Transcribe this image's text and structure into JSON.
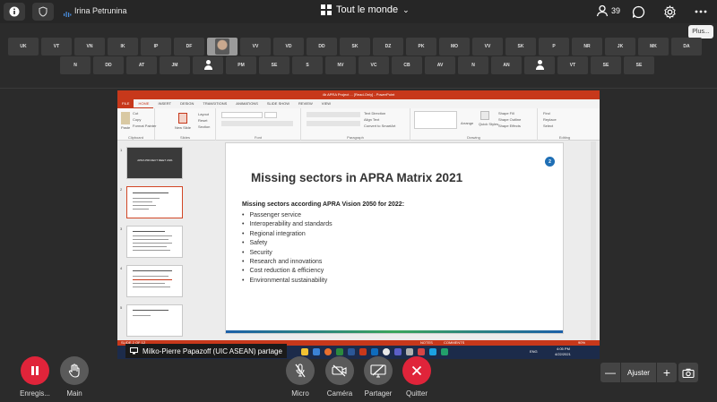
{
  "topbar": {
    "user_name": "Irina Petrunina",
    "layout_label": "Tout le monde",
    "participant_count": "39",
    "tooltip": "Plus..."
  },
  "participants": {
    "row1": [
      "UK",
      "VT",
      "VN",
      "IK",
      "IP",
      "DF",
      "",
      "VV",
      "VD",
      "DD",
      "SK",
      "DZ",
      "PK",
      "MO",
      "VV",
      "SK",
      "P",
      "NR",
      "JK",
      "MK",
      "DA"
    ],
    "row2": [
      "N",
      "DD",
      "AT",
      "JM",
      "",
      "PM",
      "SE",
      "S",
      "NV",
      "VC",
      "CB",
      "AV",
      "N",
      "AN",
      "",
      "VT",
      "SE",
      "SE"
    ]
  },
  "powerpoint": {
    "title_bar": "4b APRA Project ... [Read-Only] - PowerPoint",
    "tabs": [
      "FILE",
      "HOME",
      "INSERT",
      "DESIGN",
      "TRANSITIONS",
      "ANIMATIONS",
      "SLIDE SHOW",
      "REVIEW",
      "VIEW"
    ],
    "ribbon": {
      "groups": [
        "Clipboard",
        "Slides",
        "Font",
        "Paragraph",
        "Drawing",
        "Editing"
      ],
      "clipboard_items": [
        "Paste",
        "Cut",
        "Copy",
        "Format Painter"
      ],
      "slides_items": [
        "New Slide",
        "Layout",
        "Reset",
        "Section"
      ],
      "paragraph_items": [
        "Text Direction",
        "Align Text",
        "Convert to SmartArt"
      ],
      "drawing_items": [
        "Arrange",
        "Quick Styles",
        "Shape Fill",
        "Shape Outline",
        "Shape Effects"
      ],
      "editing_items": [
        "Find",
        "Replace",
        "Select"
      ]
    },
    "thumb_title_1": "APRA PROJECT MEET 2021",
    "slide": {
      "title": "Missing sectors in APRA Matrix 2021",
      "subtitle": "Missing sectors according APRA Vision 2050 for 2022:",
      "bullets": [
        "Passenger service",
        "Interoperability and standards",
        "Regional integration",
        "Safety",
        "Security",
        "Research and innovations",
        "Cost reduction & efficiency",
        "Environmental sustainability"
      ],
      "badge": "2"
    },
    "status": {
      "slide_pos": "SLIDE 2 OF 12",
      "notes": "NOTES",
      "comments": "COMMENTS",
      "zoom": "90%"
    }
  },
  "taskbar": {
    "time": "4:05 PM",
    "date": "4/22/2021",
    "lang": "ENG"
  },
  "sharer_label": "Milko-Pierre Papazoff (UIC ASEAN) partage",
  "controls": {
    "record": "Enregis...",
    "hand": "Main",
    "mic": "Micro",
    "camera": "Caméra",
    "share": "Partager",
    "leave": "Quitter",
    "fit": "Ajuster",
    "minus": "—",
    "plus": "+"
  },
  "colors": {
    "record": "#e0243a",
    "leave": "#e0243a",
    "ppt_accent": "#c7381b"
  }
}
